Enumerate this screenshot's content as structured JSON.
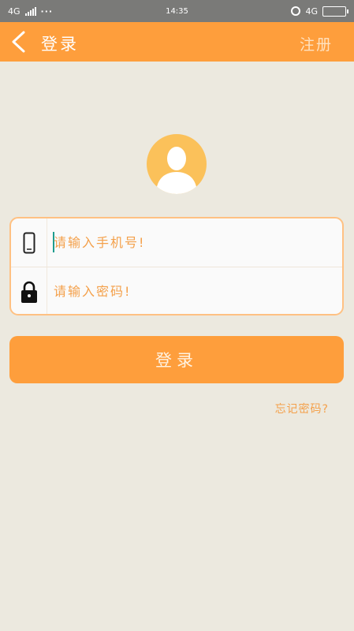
{
  "status_bar": {
    "network_left": "4G",
    "dots": "···",
    "time": "14:35",
    "network_right": "4G"
  },
  "header": {
    "title": "登录",
    "register_label": "注册"
  },
  "form": {
    "phone_placeholder": "请输入手机号!",
    "password_placeholder": "请输入密码!"
  },
  "login_button_label": "登录",
  "forgot_password_label": "忘记密码?",
  "colors": {
    "accent": "#FE9E3C",
    "background": "#ECE9DF",
    "avatar": "#FBC15A",
    "status_bar": "#7A7A78"
  },
  "icons": [
    "back-icon",
    "avatar-icon",
    "phone-icon",
    "lock-icon",
    "signal-icon",
    "alarm-icon",
    "battery-icon"
  ]
}
